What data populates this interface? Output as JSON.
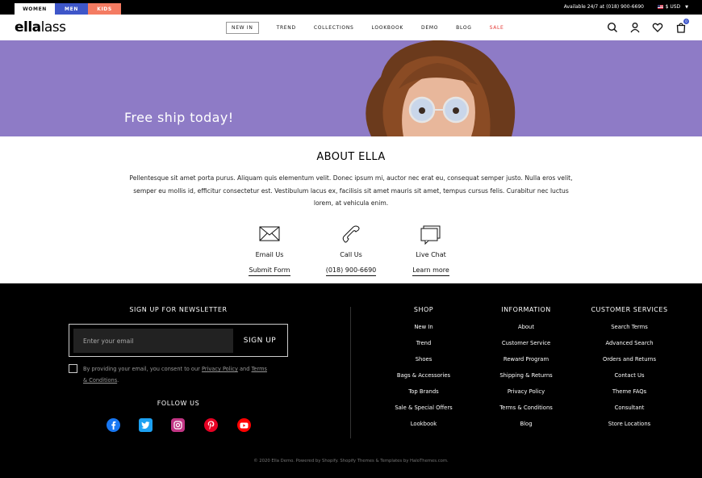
{
  "topbar": {
    "tabs": [
      "WOMEN",
      "MEN",
      "KIDS"
    ],
    "availability": "Available 24/7 at (018) 900-6690",
    "currency": "$ USD"
  },
  "header": {
    "logo_bold": "ella",
    "logo_light": "lass",
    "nav": [
      "NEW IN",
      "TREND",
      "COLLECTIONS",
      "LOOKBOOK",
      "DEMO",
      "BLOG",
      "SALE"
    ],
    "cart_count": "0"
  },
  "hero": {
    "text": "Free ship today!"
  },
  "about": {
    "title": "ABOUT ELLA",
    "text": "Pellentesque sit amet porta purus. Aliquam quis elementum velit. Donec ipsum mi, auctor nec erat eu, consequat semper justo. Nulla eros velit, semper eu mollis id, efficitur consectetur est. Vestibulum lacus ex, facilisis sit amet mauris sit amet, tempus cursus felis. Curabitur nec luctus lorem, at vehicula enim."
  },
  "contacts": [
    {
      "label": "Email Us",
      "link": "Submit Form",
      "icon": "envelope-icon"
    },
    {
      "label": "Call Us",
      "link": "(018) 900-6690",
      "icon": "phone-icon"
    },
    {
      "label": "Live Chat",
      "link": "Learn more",
      "icon": "chat-icon"
    }
  ],
  "newsletter": {
    "title": "SIGN UP FOR NEWSLETTER",
    "placeholder": "Enter your email",
    "button": "SIGN UP",
    "consent_before": "By providing your email, you consent to our ",
    "consent_link1": "Privacy Policy",
    "consent_mid": " and ",
    "consent_link2": "Terms & Conditions",
    "consent_after": ".",
    "follow": "FOLLOW US"
  },
  "social": [
    {
      "icon": "facebook-icon",
      "color": "#1877f2"
    },
    {
      "icon": "twitter-icon",
      "color": "#1da1f2"
    },
    {
      "icon": "instagram-icon",
      "color": "#e1306c"
    },
    {
      "icon": "pinterest-icon",
      "color": "#e60023"
    },
    {
      "icon": "youtube-icon",
      "color": "#ff0000"
    }
  ],
  "footer_columns": [
    {
      "title": "SHOP",
      "items": [
        "New In",
        "Trend",
        "Shoes",
        "Bags & Accessories",
        "Top Brands",
        "Sale & Special Offers",
        "Lookbook"
      ]
    },
    {
      "title": "INFORMATION",
      "items": [
        "About",
        "Customer Service",
        "Reward Program",
        "Shipping & Returns",
        "Privacy Policy",
        "Terms & Conditions",
        "Blog"
      ]
    },
    {
      "title": "CUSTOMER SERVICES",
      "items": [
        "Search Terms",
        "Advanced Search",
        "Orders and Returns",
        "Contact Us",
        "Theme FAQs",
        "Consultant",
        "Store Locations"
      ]
    }
  ],
  "copyright": "© 2020 Ella Demo. Powered by Shopify. Shopify Themes & Templates by HaloThemes.com.",
  "colors": {
    "hero_bg": "#8e7bc6",
    "men_tab": "#3e56c9",
    "kids_tab": "#f47b62",
    "sale": "#e53935"
  }
}
